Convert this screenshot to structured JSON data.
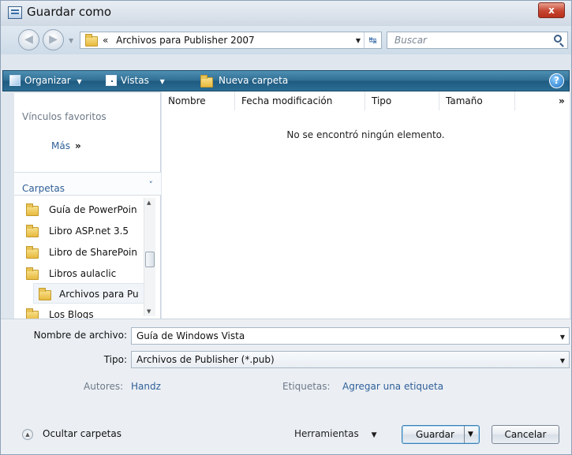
{
  "window": {
    "title": "Guardar como",
    "close_label": "x"
  },
  "address": {
    "breadcrumb_prefix": "«",
    "path": "Archivos para Publisher 2007",
    "search_placeholder": "Buscar"
  },
  "toolbar": {
    "organize": "Organizar",
    "views": "Vistas",
    "new_folder": "Nueva carpeta",
    "help": "?"
  },
  "nav": {
    "favorites_header": "Vínculos favoritos",
    "more": "Más",
    "more_arrows": "»",
    "folders_header": "Carpetas",
    "folders": [
      {
        "label": "Guía de PowerPoin"
      },
      {
        "label": "Libro ASP.net 3.5"
      },
      {
        "label": "Libro de SharePoin"
      },
      {
        "label": "Libros aulaclic"
      },
      {
        "label": "Archivos para Pu"
      },
      {
        "label": "Los Blogs"
      }
    ]
  },
  "filelist": {
    "columns": [
      "Nombre",
      "Fecha modificación",
      "Tipo",
      "Tamaño"
    ],
    "more_columns": "»",
    "empty_message": "No se encontró ningún elemento."
  },
  "form": {
    "filename_label": "Nombre de archivo:",
    "filename_value": "Guía de Windows Vista",
    "type_label": "Tipo:",
    "type_value": "Archivos de Publisher (*.pub)",
    "authors_label": "Autores:",
    "authors_value": "Handz",
    "tags_label": "Etiquetas:",
    "tags_value": "Agregar una etiqueta"
  },
  "footer": {
    "hide_folders": "Ocultar carpetas",
    "tools": "Herramientas",
    "save": "Guardar",
    "cancel": "Cancelar"
  }
}
